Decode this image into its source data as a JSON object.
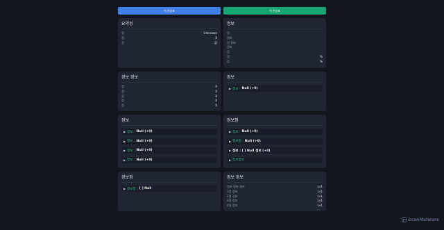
{
  "topbar": {
    "left_button": "이 전승표",
    "right_button": "이 전승표"
  },
  "cards": [
    {
      "title": "요약정",
      "rows": [
        {
          "k": "정",
          "v": "Unknown"
        },
        {
          "k": "정",
          "v": "0"
        },
        {
          "k": "정",
          "v": "없"
        }
      ]
    },
    {
      "title": "정보",
      "rows": [
        {
          "k": "정",
          "v": ""
        },
        {
          "k": "정보",
          "v": ""
        },
        {
          "k": "정 정보",
          "v": ""
        },
        {
          "k": "정보",
          "v": ""
        },
        {
          "k": "정",
          "v": ""
        },
        {
          "k": "정",
          "v": "%"
        },
        {
          "k": "정",
          "v": "%"
        }
      ]
    },
    {
      "title": "정보 정보",
      "rows": [
        {
          "k": "정",
          "v": "0"
        },
        {
          "k": "정",
          "v": "0"
        },
        {
          "k": "정",
          "v": "0"
        },
        {
          "k": "정",
          "v": "0"
        },
        {
          "k": "정",
          "v": "0"
        }
      ]
    },
    {
      "title": "정보",
      "pills": [
        {
          "label": "정보 :",
          "value": "Null (+0)"
        }
      ]
    },
    {
      "title": "정보",
      "pills": [
        {
          "label": "정보 :",
          "value": "Null (+0)"
        },
        {
          "label": "정보 :",
          "value": "Null (+0)"
        },
        {
          "label": "정보 :",
          "value": "Null (+0)"
        },
        {
          "label": "정보 :",
          "value": "Null (+0)"
        }
      ]
    },
    {
      "title": "정보정",
      "pills": [
        {
          "label": "정보 :",
          "value": "Null (+0)"
        },
        {
          "label": "정보정 :",
          "value": "Null (+0)"
        },
        {
          "label": "정보 : [ ] Null",
          "value": "정보 (+0)"
        },
        {
          "label": "정보정보",
          "value": ""
        }
      ]
    },
    {
      "title": "정보정",
      "pills": [
        {
          "label": "정보정 :",
          "value": "[ ] Null"
        }
      ]
    },
    {
      "title": "정보 정보",
      "rows": [
        {
          "k": "정보 정보 정보",
          "v": "Lv1"
        },
        {
          "k": "1정 정보",
          "v": "Lv1"
        },
        {
          "k": "2정 정보",
          "v": "Lv1"
        },
        {
          "k": "3정 정보",
          "v": "Lv1"
        },
        {
          "k": "4정 정보",
          "v": "Lv1"
        }
      ]
    }
  ],
  "watermark": "ScanMalware"
}
